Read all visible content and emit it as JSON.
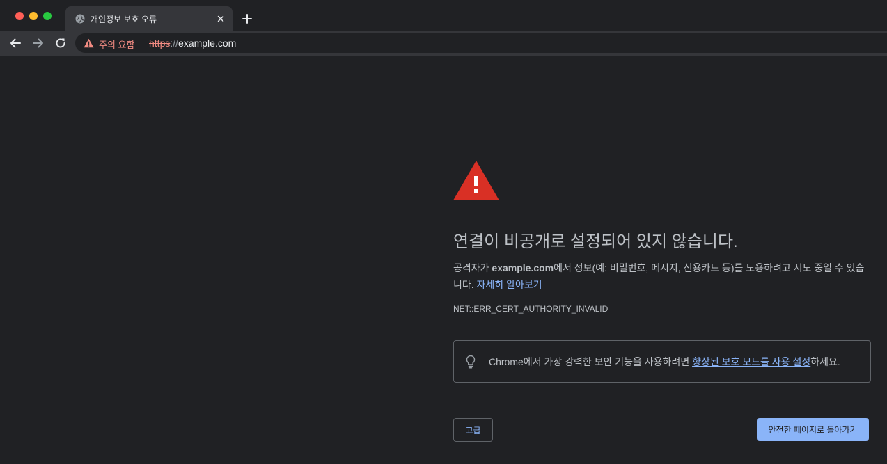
{
  "colors": {
    "background": "#202124",
    "toolbar": "#35363a",
    "warning_red": "#d93025",
    "warning_text": "#f28b82",
    "link_blue": "#8ab4f8",
    "body_text": "#bdc1c6"
  },
  "tab": {
    "title": "개인정보 보호 오류",
    "favicon": "globe-icon",
    "close_icon": "close-icon"
  },
  "toolbar": {
    "security_label": "주의 요함",
    "url": {
      "scheme": "https",
      "separator": "://",
      "host": "example.com"
    }
  },
  "interstitial": {
    "icon": "warning-triangle-icon",
    "headline": "연결이 비공개로 설정되어 있지 않습니다.",
    "body": {
      "prefix": "공격자가 ",
      "host": "example.com",
      "suffix": "에서 정보(예: 비밀번호, 메시지, 신용카드 등)를 도용하려고 시도 중일 수 있습니다. ",
      "learn_more": "자세히 알아보기"
    },
    "error_code": "NET::ERR_CERT_AUTHORITY_INVALID",
    "enhanced": {
      "icon": "lightbulb-icon",
      "prefix": "Chrome에서 가장 강력한 보안 기능을 사용하려면 ",
      "link": "향상된 보호 모드를 사용 설정",
      "suffix": "하세요."
    },
    "advanced_button": "고급",
    "back_button": "안전한 페이지로 돌아가기"
  }
}
